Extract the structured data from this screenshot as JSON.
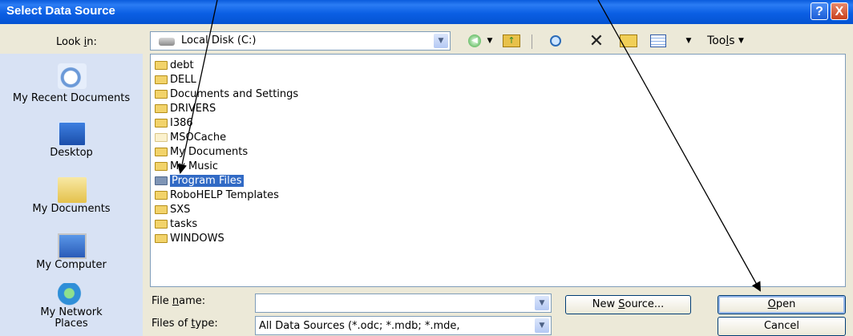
{
  "window": {
    "title": "Select Data Source",
    "help_button": "?",
    "close_button": "X"
  },
  "toolbar": {
    "look_in_pre": "Look ",
    "look_in_key": "i",
    "look_in_post": "n:",
    "location": "Local Disk (C:)",
    "tools_pre": "Too",
    "tools_key": "l",
    "tools_post": "s"
  },
  "places": [
    {
      "label": "My Recent Documents",
      "icon": "recent-documents-icon"
    },
    {
      "label": "Desktop",
      "icon": "desktop-icon"
    },
    {
      "label": "My Documents",
      "icon": "my-documents-icon"
    },
    {
      "label": "My Computer",
      "icon": "my-computer-icon"
    },
    {
      "label": "My Network Places",
      "icon": "network-places-icon"
    }
  ],
  "files": [
    {
      "name": "debt"
    },
    {
      "name": "DELL"
    },
    {
      "name": "Documents and Settings"
    },
    {
      "name": "DRIVERS"
    },
    {
      "name": "I386"
    },
    {
      "name": "MSOCache"
    },
    {
      "name": "My Documents"
    },
    {
      "name": "My Music"
    },
    {
      "name": "Program Files",
      "selected": true
    },
    {
      "name": "RoboHELP Templates"
    },
    {
      "name": "SXS"
    },
    {
      "name": "tasks"
    },
    {
      "name": "WINDOWS"
    }
  ],
  "bottom": {
    "filename_pre": "File ",
    "filename_key": "n",
    "filename_post": "ame:",
    "filename_value": "",
    "filetype_pre": "Files of ",
    "filetype_key": "t",
    "filetype_post": "ype:",
    "filetype_value": "All Data Sources (*.odc; *.mdb; *.mde,",
    "new_source_pre": "New ",
    "new_source_key": "S",
    "new_source_post": "ource...",
    "open_key": "O",
    "open_post": "pen",
    "cancel": "Cancel"
  },
  "colors": {
    "titlebar": "#0a5bdc",
    "selection": "#316ac5",
    "places_bar": "#d8e2f4"
  }
}
